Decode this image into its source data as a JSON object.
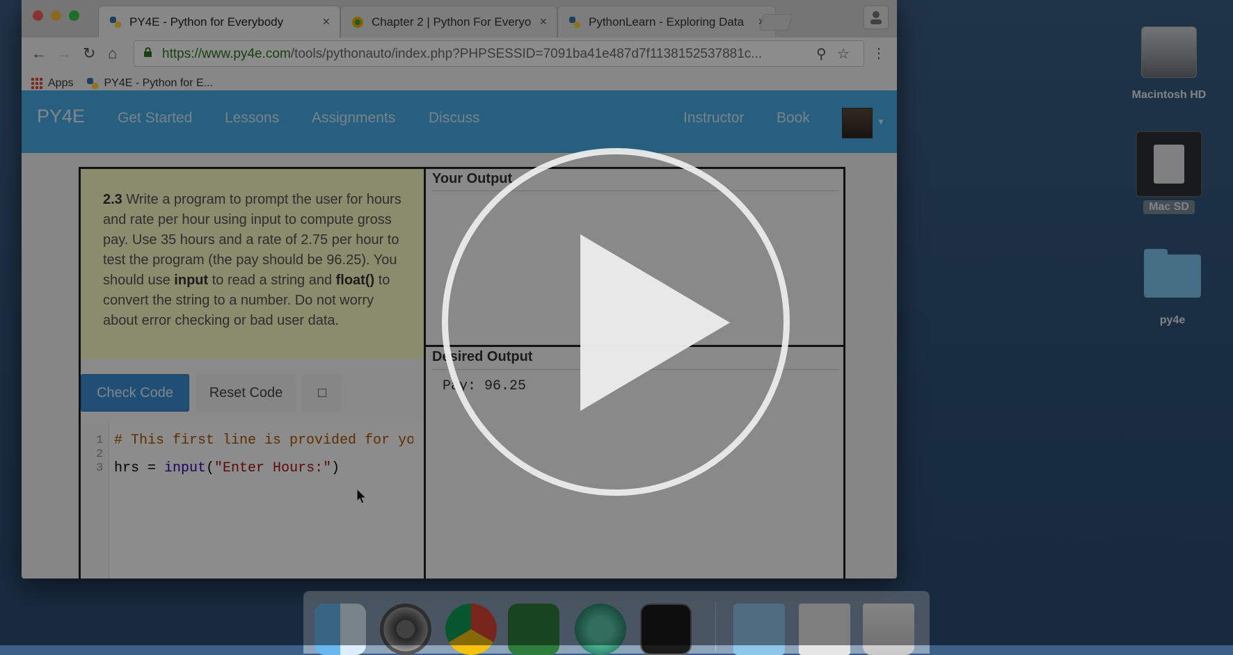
{
  "browser": {
    "tabs": [
      {
        "title": "PY4E - Python for Everybody",
        "active": true
      },
      {
        "title": "Chapter 2 | Python For Everyo",
        "active": false
      },
      {
        "title": "PythonLearn - Exploring Data",
        "active": false
      }
    ],
    "tab_close_glyph": "×",
    "url_host": "https://www.py4e.com",
    "url_rest": "/tools/pythonauto/index.php?PHPSESSID=7091ba41e487d7f1138152537881c...",
    "bookmarks": {
      "apps": "Apps",
      "py4e": "PY4E - Python for E..."
    },
    "icons": {
      "back": "arrow-left-icon",
      "forward": "arrow-right-icon",
      "reload": "reload-icon",
      "home": "home-icon",
      "lock": "lock-icon",
      "zoom": "zoom-icon",
      "star": "star-icon",
      "menu": "more-vertical-icon",
      "profile": "person-icon"
    }
  },
  "site": {
    "brand": "PY4E",
    "nav": [
      "Get Started",
      "Lessons",
      "Assignments",
      "Discuss"
    ],
    "nav_right": [
      "Instructor",
      "Book"
    ]
  },
  "exercise": {
    "number": "2.3",
    "instructions": {
      "p1": " Write a program to prompt the user for hours and rate per hour using input to compute gross pay. Use 35 hours and a rate of 2.75 per hour to test the program (the pay should be 96.25). You should use ",
      "kw1": "input",
      "p2": " to read a string and ",
      "kw2": "float()",
      "p3": " to convert the string to a number. Do not worry about error checking or bad user data."
    },
    "buttons": {
      "check": "Check Code",
      "reset": "Reset Code",
      "square": "□"
    },
    "code": {
      "line_numbers": [
        "1",
        "2",
        "3"
      ],
      "line1_comment": "# This first line is provided for you",
      "line3_var": "hrs = ",
      "line3_fn": "input",
      "line3_open": "(",
      "line3_str": "\"Enter Hours:\"",
      "line3_close": ")"
    },
    "your_output_title": "Your Output",
    "desired_output_title": "Desired Output",
    "desired_output_text": "Pay: 96.25"
  },
  "desktop": {
    "icons": [
      "Macintosh HD",
      "Mac SD",
      "py4e"
    ]
  },
  "video": {
    "play_icon": "play-icon"
  }
}
